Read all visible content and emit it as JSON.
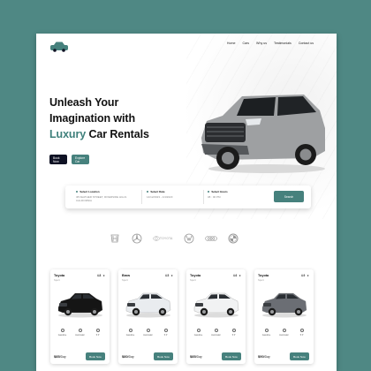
{
  "nav": {
    "items": [
      "Home",
      "Cars",
      "Why us",
      "Testimonials",
      "Contact us"
    ]
  },
  "hero": {
    "line1": "Unleash Your",
    "line2": "Imagination with",
    "accent": "Luxury",
    "line3_rest": " Car Rentals",
    "btn_primary": "Book Now",
    "btn_secondary": "Explore Car"
  },
  "search": {
    "location_label": "Select Location",
    "location_value_1": "38 FEATHER STREET, RIVERSIDE HILLS",
    "location_value_2": "CALIFORNIA",
    "date_label": "Select Date",
    "date_value": "14/12/2023  -  1/4/2023",
    "hours_label": "Select Hours",
    "hours_value": "08 : 00  PM",
    "button": "Search"
  },
  "brands": [
    "honda-logo-icon",
    "mercedes-logo-icon",
    "toyota-logo-icon",
    "volkswagen-logo-icon",
    "audi-logo-icon",
    "bmw-logo-icon"
  ],
  "brand_words": {
    "toyota": "TOYOTA"
  },
  "cars": [
    {
      "name": "Toyota",
      "sub": "Sport",
      "rating": "4.8",
      "price": "$85",
      "per": "/Day",
      "color": "#151515",
      "specs": [
        "Gasoline",
        "Automatic",
        "5 P"
      ],
      "book": "Book Now"
    },
    {
      "name": "Bmw",
      "sub": "Sport",
      "rating": "4.5",
      "price": "$80",
      "per": "/Day",
      "color": "#e9ecef",
      "specs": [
        "Gasoline",
        "Automatic",
        "5 P"
      ],
      "book": "Book Now"
    },
    {
      "name": "Toyota",
      "sub": "Sport",
      "rating": "4.6",
      "price": "$85",
      "per": "/Day",
      "color": "#f1f2f3",
      "specs": [
        "Gasoline",
        "Automatic",
        "5 P"
      ],
      "book": "Book Now"
    },
    {
      "name": "Toyota",
      "sub": "Sport",
      "rating": "4.9",
      "price": "$90",
      "per": "/Day",
      "color": "#6b6e74",
      "specs": [
        "Gasoline",
        "Automatic",
        "5 P"
      ],
      "book": "Book Now"
    }
  ],
  "colors": {
    "accent": "#46817d",
    "background": "#4f8884",
    "dark": "#0f1224"
  }
}
